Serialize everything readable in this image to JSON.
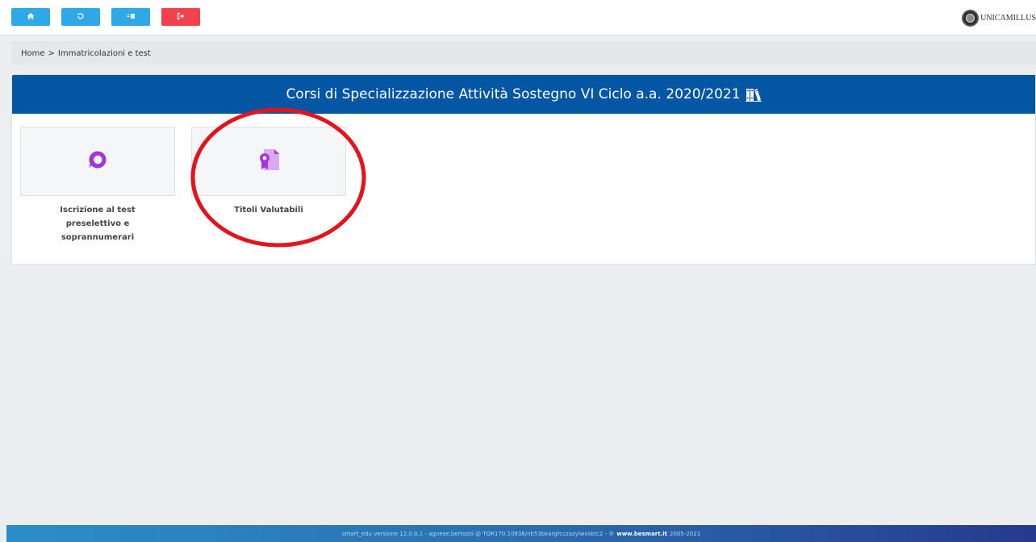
{
  "topbar": {
    "buttons": [
      {
        "name": "home",
        "icon": "home-icon",
        "color": "#2ea8e6"
      },
      {
        "name": "history",
        "icon": "history-icon",
        "color": "#2ea8e6"
      },
      {
        "name": "id-card",
        "icon": "id-card-icon",
        "color": "#2ea8e6"
      },
      {
        "name": "logout",
        "icon": "logout-icon",
        "color": "#f0414d"
      }
    ],
    "brand": "UNICAMILLUS"
  },
  "breadcrumb": {
    "home": "Home",
    "separator": ">",
    "current": "Immatricolazioni e test"
  },
  "panel": {
    "title": "Corsi di Specializzazione Attività Sostegno VI Ciclo a.a. 2020/2021",
    "header_color": "#0356a4",
    "cards": [
      {
        "label": "Iscrizione al test preselettivo e soprannumerari",
        "icon": "chat-bubble-icon"
      },
      {
        "label": "Titoli Valutabili",
        "icon": "certificate-document-icon"
      }
    ]
  },
  "annotation": {
    "color": "#e3141c"
  },
  "footer": {
    "text": "smart_edu versione 12.0.0.1 - agnese.bertozzi @ TOR170.10836/nb53bkargfcczazyiwxsktc2 - ®",
    "link": "www.besmart.it",
    "years": "2005-2021"
  }
}
